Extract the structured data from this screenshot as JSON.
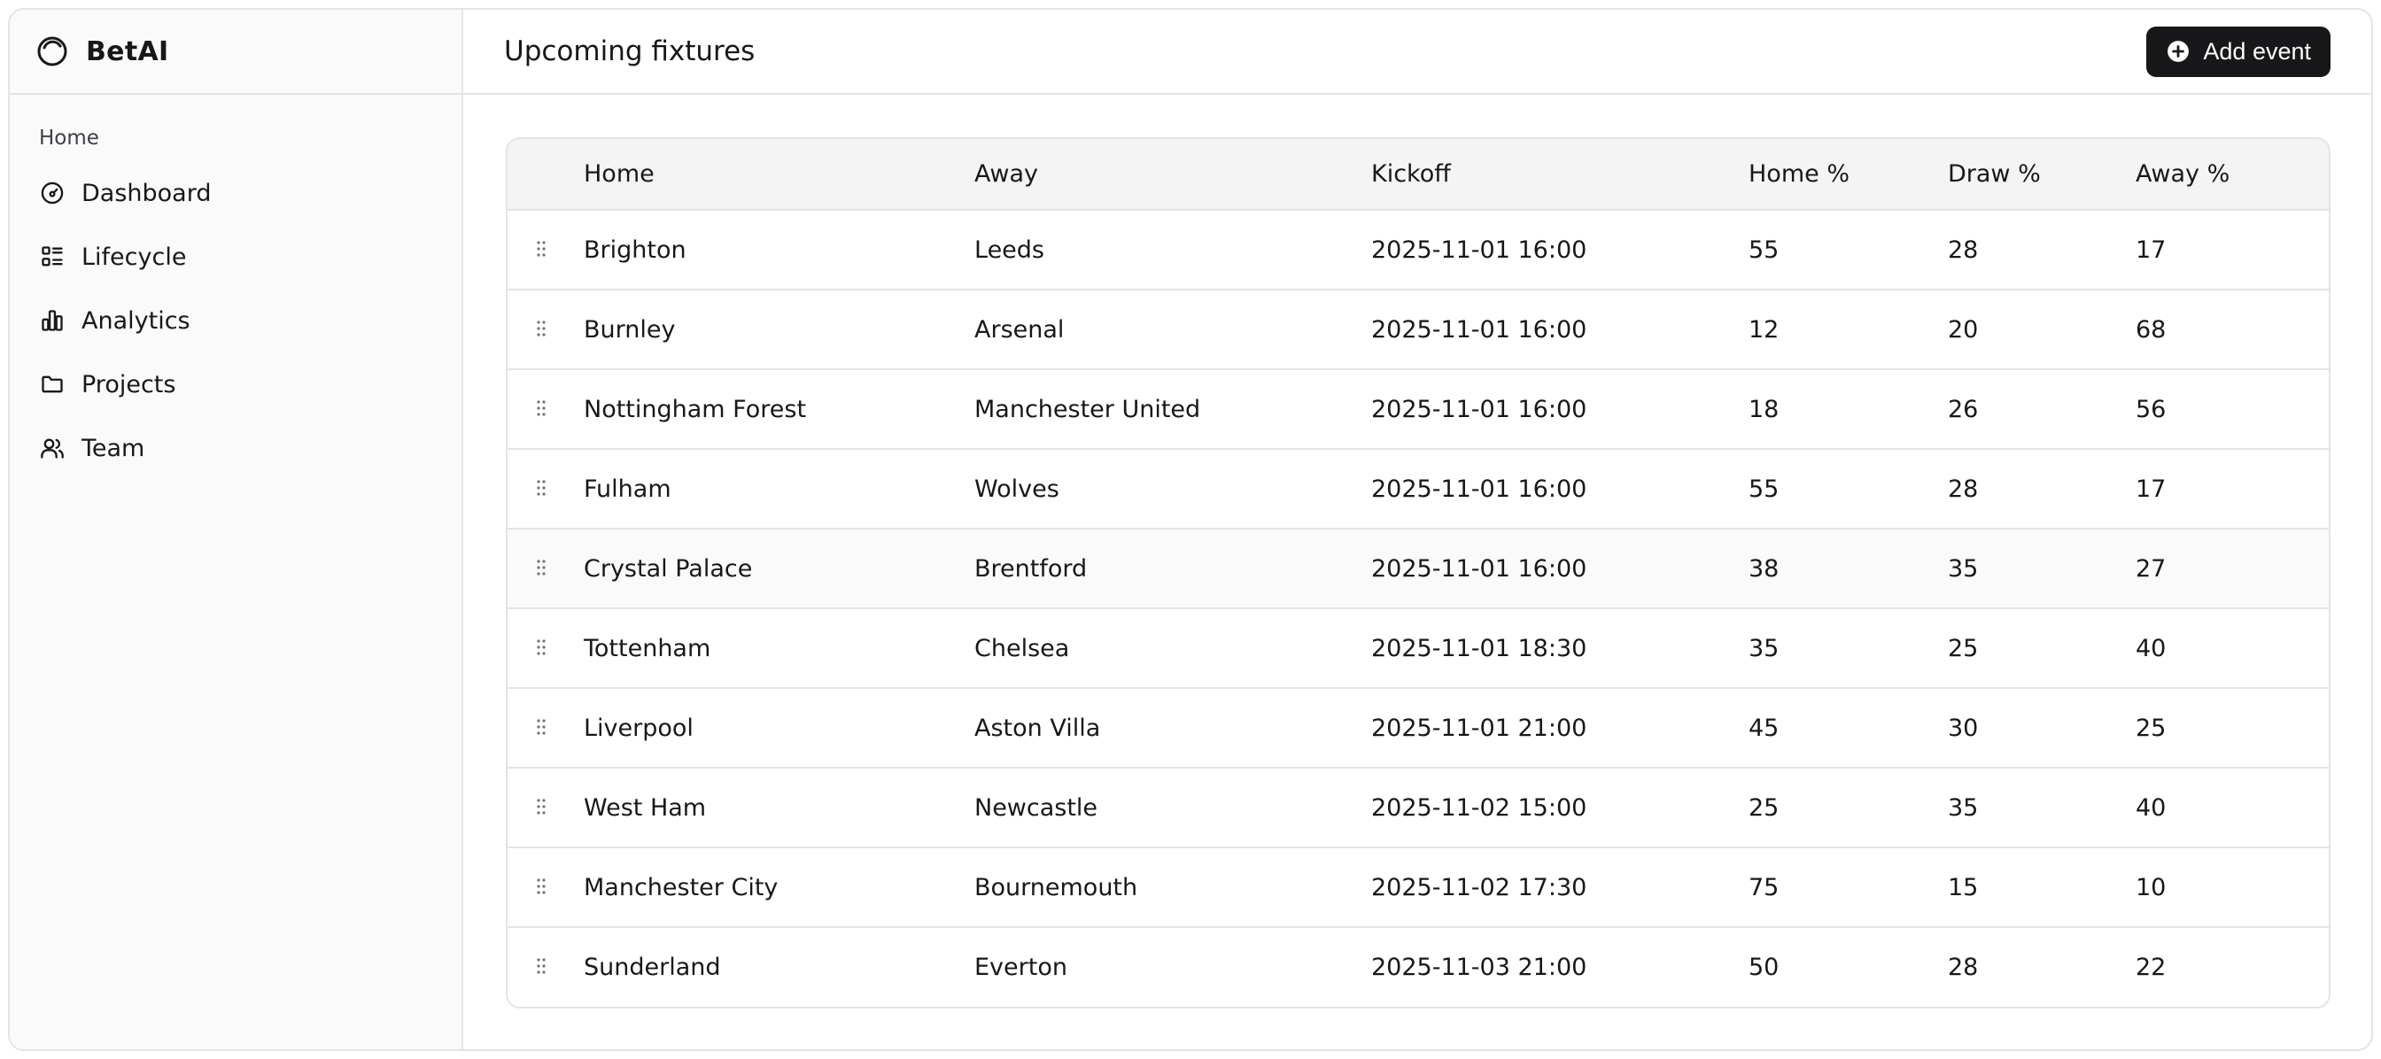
{
  "brand": {
    "name": "BetAI"
  },
  "sidebar": {
    "section_label": "Home",
    "items": [
      {
        "label": "Dashboard",
        "icon": "gauge-icon"
      },
      {
        "label": "Lifecycle",
        "icon": "list-checks-icon"
      },
      {
        "label": "Analytics",
        "icon": "bar-chart-icon"
      },
      {
        "label": "Projects",
        "icon": "folder-icon"
      },
      {
        "label": "Team",
        "icon": "users-icon"
      }
    ]
  },
  "header": {
    "title": "Upcoming fixtures",
    "add_button_label": "Add event",
    "add_button_icon": "plus-circle-icon"
  },
  "table": {
    "columns": [
      "Home",
      "Away",
      "Kickoff",
      "Home %",
      "Draw %",
      "Away %"
    ],
    "rows": [
      {
        "home": "Brighton",
        "away": "Leeds",
        "kickoff": "2025-11-01 16:00",
        "home_pct": "55",
        "draw_pct": "28",
        "away_pct": "17"
      },
      {
        "home": "Burnley",
        "away": "Arsenal",
        "kickoff": "2025-11-01 16:00",
        "home_pct": "12",
        "draw_pct": "20",
        "away_pct": "68"
      },
      {
        "home": "Nottingham Forest",
        "away": "Manchester United",
        "kickoff": "2025-11-01 16:00",
        "home_pct": "18",
        "draw_pct": "26",
        "away_pct": "56"
      },
      {
        "home": "Fulham",
        "away": "Wolves",
        "kickoff": "2025-11-01 16:00",
        "home_pct": "55",
        "draw_pct": "28",
        "away_pct": "17"
      },
      {
        "home": "Crystal Palace",
        "away": "Brentford",
        "kickoff": "2025-11-01 16:00",
        "home_pct": "38",
        "draw_pct": "35",
        "away_pct": "27"
      },
      {
        "home": "Tottenham",
        "away": "Chelsea",
        "kickoff": "2025-11-01 18:30",
        "home_pct": "35",
        "draw_pct": "25",
        "away_pct": "40"
      },
      {
        "home": "Liverpool",
        "away": "Aston Villa",
        "kickoff": "2025-11-01 21:00",
        "home_pct": "45",
        "draw_pct": "30",
        "away_pct": "25"
      },
      {
        "home": "West Ham",
        "away": "Newcastle",
        "kickoff": "2025-11-02 15:00",
        "home_pct": "25",
        "draw_pct": "35",
        "away_pct": "40"
      },
      {
        "home": "Manchester City",
        "away": "Bournemouth",
        "kickoff": "2025-11-02 17:30",
        "home_pct": "75",
        "draw_pct": "15",
        "away_pct": "10"
      },
      {
        "home": "Sunderland",
        "away": "Everton",
        "kickoff": "2025-11-03 21:00",
        "home_pct": "50",
        "draw_pct": "28",
        "away_pct": "22"
      }
    ]
  },
  "colors": {
    "accent": "#18181b",
    "border": "#e4e4e7",
    "sidebar_bg": "#fafafa",
    "table_header_bg": "#f4f4f5"
  }
}
